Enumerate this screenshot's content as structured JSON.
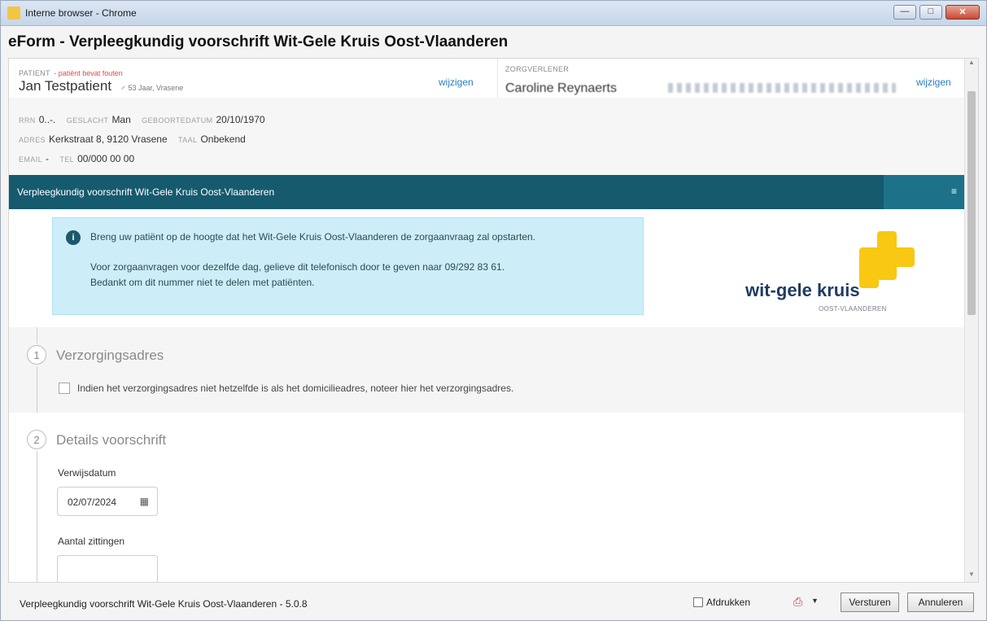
{
  "window": {
    "title": "Interne browser - Chrome",
    "min": "—",
    "max": "□",
    "close": "✕"
  },
  "eform_title": "eForm - Verpleegkundig voorschrift Wit-Gele Kruis Oost-Vlaanderen",
  "patient": {
    "label": "PATIENT",
    "error": "- patiënt bevat fouten",
    "name": "Jan Testpatient",
    "gender_symbol": "♂",
    "meta": "53 Jaar, Vrasene",
    "edit_link": "wijzigen"
  },
  "zorgverlener": {
    "label": "ZORGVERLENER",
    "name": "Caroline Reynaerts",
    "edit_link": "wijzigen"
  },
  "details": {
    "rrn_k": "RRN",
    "rrn_v": "0..-.",
    "geslacht_k": "GESLACHT",
    "geslacht_v": "Man",
    "geboortedatum_k": "GEBOORTEDATUM",
    "geboortedatum_v": "20/10/1970",
    "adres_k": "ADRES",
    "adres_v": "Kerkstraat 8, 9120 Vrasene",
    "taal_k": "TAAL",
    "taal_v": "Onbekend",
    "email_k": "EMAIL",
    "email_v": "-",
    "tel_k": "TEL",
    "tel_v": "00/000 00 00"
  },
  "section_bar": {
    "title": "Verpleegkundig voorschrift Wit-Gele Kruis Oost-Vlaanderen",
    "menu": "≡"
  },
  "alert": {
    "icon": "i",
    "line1": "Breng uw patiënt op de hoogte dat het Wit-Gele Kruis Oost-Vlaanderen de zorgaanvraag zal opstarten.",
    "line2": "Voor zorgaanvragen voor dezelfde dag, gelieve dit telefonisch door te geven naar 09/292 83 61.",
    "line3": "Bedankt om dit nummer niet te delen met patiënten."
  },
  "logo": {
    "text": "wit-gele kruis",
    "sub": "OOST-VLAANDEREN",
    "color": "#f8c812"
  },
  "step1": {
    "number": "1",
    "title": "Verzorgingsadres",
    "checkbox_label": "Indien het verzorgingsadres niet hetzelfde is als het domicilieadres, noteer hier het verzorgingsadres."
  },
  "step2": {
    "number": "2",
    "title": "Details voorschrift",
    "verwijsdatum_label": "Verwijsdatum",
    "verwijsdatum_value": "02/07/2024",
    "zittingen_label": "Aantal zittingen",
    "zittingen_value": ""
  },
  "footer": {
    "title": "Verpleegkundig voorschrift Wit-Gele Kruis Oost-Vlaanderen - 5.0.8",
    "print_label": "Afdrukken",
    "send": "Versturen",
    "cancel": "Annuleren"
  },
  "colors": {
    "section_bar": "#165a6e",
    "alert_bg": "#cdeef8",
    "link": "#2a7dbf"
  }
}
